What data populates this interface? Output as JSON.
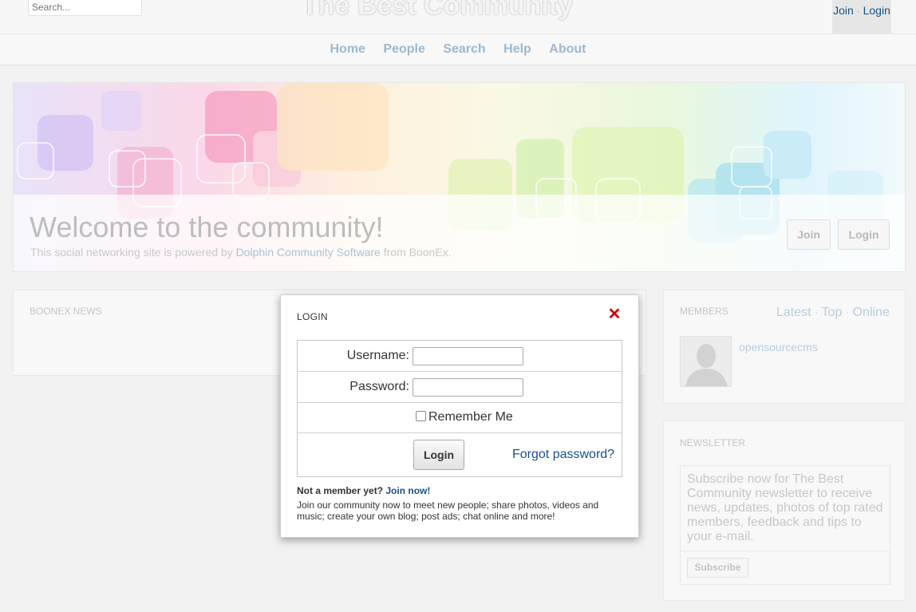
{
  "header": {
    "search_placeholder": "Search...",
    "site_title": "The Best Community",
    "join_label": "Join",
    "separator": "·",
    "login_label": "Login"
  },
  "nav": {
    "items": [
      {
        "label": "Home"
      },
      {
        "label": "People"
      },
      {
        "label": "Search"
      },
      {
        "label": "Help"
      },
      {
        "label": "About"
      }
    ]
  },
  "hero": {
    "title": "Welcome to the community!",
    "subtitle_prefix": "This social networking site is powered by ",
    "subtitle_link": "Dolphin Community Software",
    "subtitle_suffix": " from BoonEx.",
    "join_button": "Join",
    "login_button": "Login"
  },
  "news_panel": {
    "title": "BOONEX NEWS"
  },
  "members_panel": {
    "title": "MEMBERS",
    "links": [
      "Latest",
      "Top",
      "Online"
    ],
    "separator": "·",
    "member_name": "opensourcecms"
  },
  "newsletter_panel": {
    "title": "NEWSLETTER",
    "text": "Subscribe now for The Best Community newsletter to receive news, updates, photos of top rated members, feedback and tips to your e-mail.",
    "subscribe_button": "Subscribe"
  },
  "login_modal": {
    "title": "LOGIN",
    "close_icon": "close-icon",
    "close_color": "#cc0000",
    "username_label": "Username:",
    "username_value": "",
    "password_label": "Password:",
    "password_value": "",
    "remember_label": "Remember Me",
    "remember_checked": false,
    "login_button": "Login",
    "forgot_link": "Forgot password?",
    "not_member_text": "Not a member yet?",
    "join_now_link": "Join now!",
    "description": "Join our community now to meet new people; share photos, videos and music; create your own blog; post ads; chat online and more!"
  },
  "colors": {
    "link": "#1a4f8a",
    "nav_faded": "#9cb8d1"
  }
}
